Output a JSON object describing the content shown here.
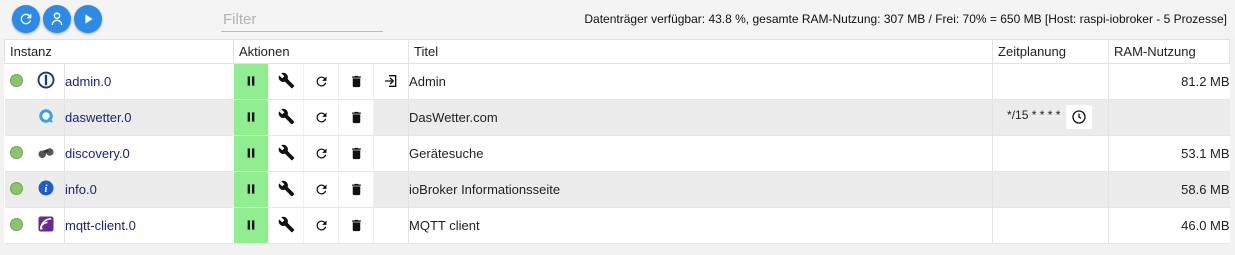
{
  "toolbar": {
    "reload_icon": "refresh-icon",
    "expert_icon": "expert-mode-icon",
    "start_icon": "play-icon",
    "filter_placeholder": "Filter",
    "filter_value": ""
  },
  "sysinfo": {
    "text": "Datenträger verfügbar: 43.8 %, gesamte RAM-Nutzung: 307 MB / Frei: 70% = 650 MB [Host: raspi-iobroker - 5 Prozesse]"
  },
  "columns": {
    "instance": "Instanz",
    "actions": "Aktionen",
    "title": "Titel",
    "schedule": "Zeitplanung",
    "ram": "RAM-Nutzung"
  },
  "rows": [
    {
      "name": "admin.0",
      "title": "Admin",
      "schedule": "",
      "ram": "81.2 MB",
      "status": "green",
      "icon": "admin-logo-icon",
      "has_status": true,
      "has_open": true,
      "has_schedule": false
    },
    {
      "name": "daswetter.0",
      "title": "DasWetter.com",
      "schedule": "*/15 * * * *",
      "ram": "",
      "status": "none",
      "icon": "daswetter-logo-icon",
      "has_status": false,
      "has_open": false,
      "has_schedule": true
    },
    {
      "name": "discovery.0",
      "title": "Gerätesuche",
      "schedule": "",
      "ram": "53.1 MB",
      "status": "green",
      "icon": "binoculars-icon",
      "has_status": true,
      "has_open": false,
      "has_schedule": false
    },
    {
      "name": "info.0",
      "title": "ioBroker Informationsseite",
      "schedule": "",
      "ram": "58.6 MB",
      "status": "green",
      "icon": "info-logo-icon",
      "has_status": true,
      "has_open": false,
      "has_schedule": false
    },
    {
      "name": "mqtt-client.0",
      "title": "MQTT client",
      "schedule": "",
      "ram": "46.0 MB",
      "status": "green",
      "icon": "mqtt-logo-icon",
      "has_status": true,
      "has_open": false,
      "has_schedule": false
    }
  ],
  "colors": {
    "accent": "#2d8ae6",
    "pause_bg": "#90ee90",
    "status_green": "#8cc46c",
    "instance_link": "#1a237e"
  }
}
